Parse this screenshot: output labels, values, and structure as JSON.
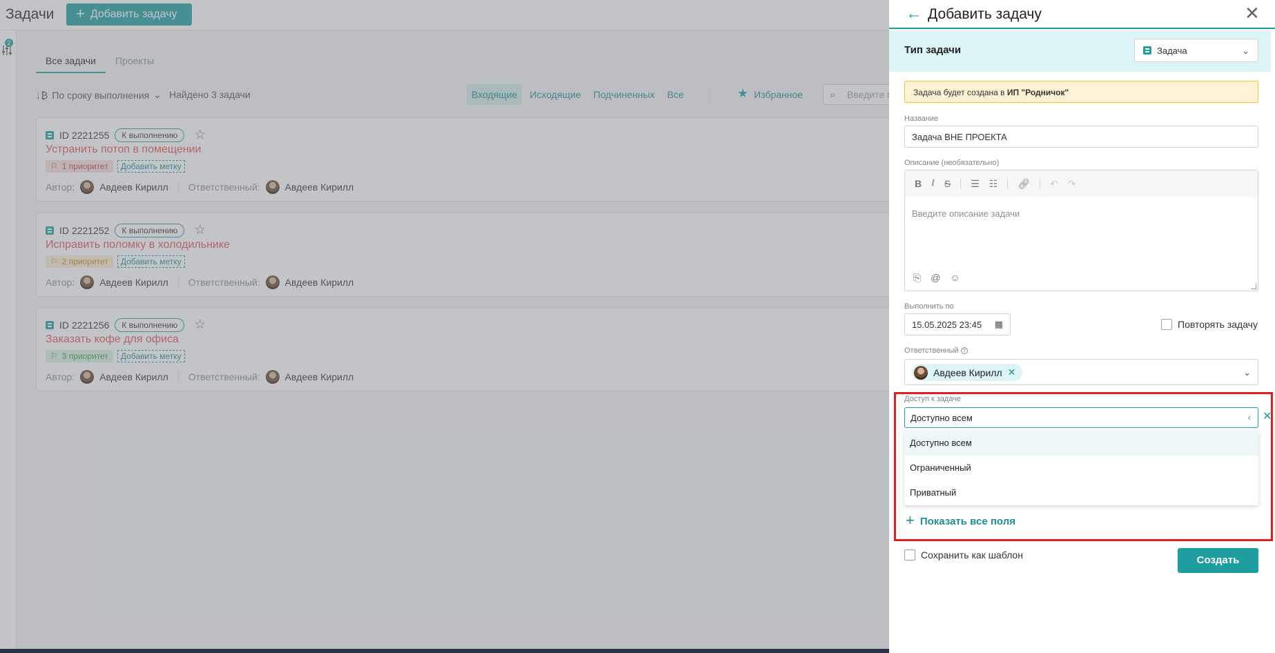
{
  "app": {
    "title": "Задачи",
    "add_button": "Добавить задачу",
    "filter_badge": "2",
    "tabs": [
      {
        "label": "Все задачи"
      },
      {
        "label": "Проекты"
      }
    ],
    "sort_label": "По сроку выполнения",
    "found_label": "Найдено 3 задачи",
    "filters": [
      {
        "label": "Входящие"
      },
      {
        "label": "Исходящие"
      },
      {
        "label": "Подчиненных"
      },
      {
        "label": "Все"
      }
    ],
    "favorites_label": "Избранное",
    "search_placeholder": "Введите п",
    "tasks": [
      {
        "id": "ID 2221255",
        "status": "К выполнению",
        "title": "Устранить потоп в помещении",
        "priority": "1 приоритет",
        "add_tag": "Добавить метку",
        "author_label": "Автор:",
        "author": "Авдеев Кирилл",
        "resp_label": "Ответственный:",
        "responsible": "Авдеев Кирилл"
      },
      {
        "id": "ID 2221252",
        "status": "К выполнению",
        "title": "Исправить поломку в холодильнике",
        "priority": "2 приоритет",
        "add_tag": "Добавить метку",
        "author_label": "Автор:",
        "author": "Авдеев Кирилл",
        "resp_label": "Ответственный:",
        "responsible": "Авдеев Кирилл"
      },
      {
        "id": "ID 2221256",
        "status": "К выполнению",
        "title": "Заказать кофе для офиса",
        "priority": "3 приоритет",
        "add_tag": "Добавить метку",
        "author_label": "Автор:",
        "author": "Авдеев Кирилл",
        "resp_label": "Ответственный:",
        "responsible": "Авдеев Кирилл"
      }
    ]
  },
  "drawer": {
    "title": "Добавить задачу",
    "type_label": "Тип задачи",
    "type_value": "Задача",
    "notice_prefix": "Задача будет создана в ",
    "notice_org": "ИП \"Родничок\"",
    "name_label": "Название",
    "name_value": "Задача ВНЕ ПРОЕКТА",
    "desc_label": "Описание (необязательно)",
    "desc_placeholder": "Введите описание задачи",
    "due_label": "Выполнить по",
    "due_value": "15.05.2025 23:45",
    "repeat_label": "Повторять задачу",
    "responsible_label": "Ответственный",
    "responsible_value": "Авдеев Кирилл",
    "access_label": "Доступ к задаче",
    "access_value": "Доступно всем",
    "access_options": [
      {
        "label": "Доступно всем"
      },
      {
        "label": "Ограниченный"
      },
      {
        "label": "Приватный"
      }
    ],
    "show_all_label": "Показать все поля",
    "save_template_label": "Сохранить как шаблон",
    "create_label": "Создать"
  },
  "colors": {
    "accent": "#1e9ea0",
    "highlight": "#e02020",
    "title_red": "#e25555"
  }
}
